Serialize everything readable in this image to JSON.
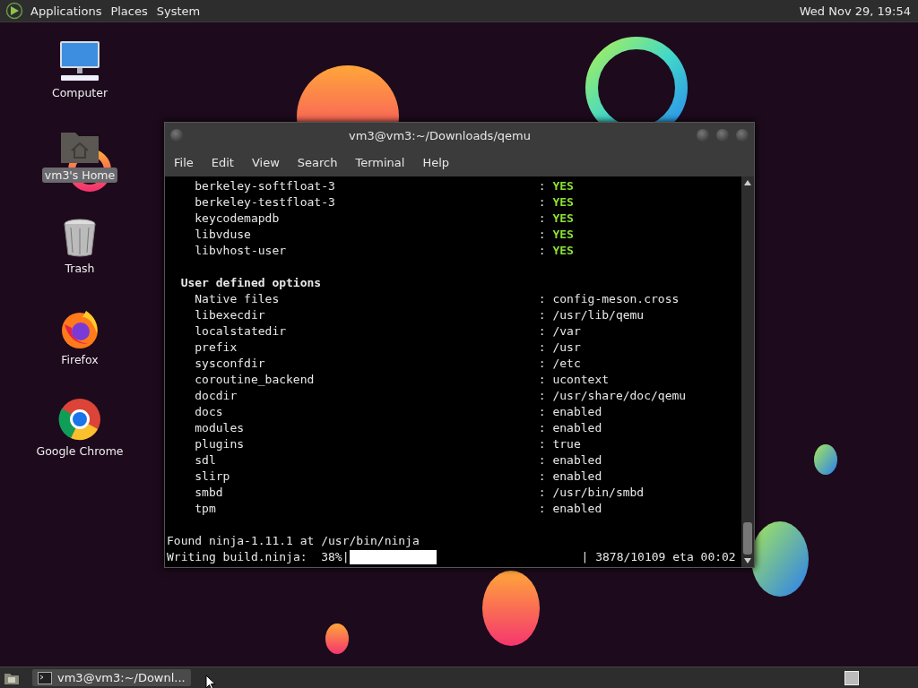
{
  "top_panel": {
    "menus": [
      "Applications",
      "Places",
      "System"
    ],
    "clock": "Wed Nov 29, 19:54"
  },
  "desktop_icons": [
    {
      "label": "Computer",
      "kind": "computer",
      "selected": false
    },
    {
      "label": "vm3's Home",
      "kind": "home",
      "selected": true
    },
    {
      "label": "Trash",
      "kind": "trash",
      "selected": false
    },
    {
      "label": "Firefox",
      "kind": "firefox",
      "selected": false
    },
    {
      "label": "Google Chrome",
      "kind": "chrome",
      "selected": false
    }
  ],
  "window": {
    "title": "vm3@vm3:~/Downloads/qemu",
    "menu": [
      "File",
      "Edit",
      "View",
      "Search",
      "Terminal",
      "Help"
    ]
  },
  "terminal_lines": [
    {
      "kind": "entry",
      "key": "berkeley-softfloat-3",
      "sep": ":",
      "value": "YES",
      "highlight": true
    },
    {
      "kind": "entry",
      "key": "berkeley-testfloat-3",
      "sep": ":",
      "value": "YES",
      "highlight": true
    },
    {
      "kind": "entry",
      "key": "keycodemapdb",
      "sep": ":",
      "value": "YES",
      "highlight": true
    },
    {
      "kind": "entry",
      "key": "libvduse",
      "sep": ":",
      "value": "YES",
      "highlight": true
    },
    {
      "kind": "entry",
      "key": "libvhost-user",
      "sep": ":",
      "value": "YES",
      "highlight": true
    },
    {
      "kind": "blank"
    },
    {
      "kind": "heading",
      "text": "User defined options"
    },
    {
      "kind": "entry",
      "key": "Native files",
      "sep": ":",
      "value": "config-meson.cross",
      "highlight": false
    },
    {
      "kind": "entry",
      "key": "libexecdir",
      "sep": ":",
      "value": "/usr/lib/qemu",
      "highlight": false
    },
    {
      "kind": "entry",
      "key": "localstatedir",
      "sep": ":",
      "value": "/var",
      "highlight": false
    },
    {
      "kind": "entry",
      "key": "prefix",
      "sep": ":",
      "value": "/usr",
      "highlight": false
    },
    {
      "kind": "entry",
      "key": "sysconfdir",
      "sep": ":",
      "value": "/etc",
      "highlight": false
    },
    {
      "kind": "entry",
      "key": "coroutine_backend",
      "sep": ":",
      "value": "ucontext",
      "highlight": false
    },
    {
      "kind": "entry",
      "key": "docdir",
      "sep": ":",
      "value": "/usr/share/doc/qemu",
      "highlight": false
    },
    {
      "kind": "entry",
      "key": "docs",
      "sep": ":",
      "value": "enabled",
      "highlight": false
    },
    {
      "kind": "entry",
      "key": "modules",
      "sep": ":",
      "value": "enabled",
      "highlight": false
    },
    {
      "kind": "entry",
      "key": "plugins",
      "sep": ":",
      "value": "true",
      "highlight": false
    },
    {
      "kind": "entry",
      "key": "sdl",
      "sep": ":",
      "value": "enabled",
      "highlight": false
    },
    {
      "kind": "entry",
      "key": "slirp",
      "sep": ":",
      "value": "enabled",
      "highlight": false
    },
    {
      "kind": "entry",
      "key": "smbd",
      "sep": ":",
      "value": "/usr/bin/smbd",
      "highlight": false
    },
    {
      "kind": "entry",
      "key": "tpm",
      "sep": ":",
      "value": "enabled",
      "highlight": false
    },
    {
      "kind": "blank"
    },
    {
      "kind": "text",
      "text": "Found ninja-1.11.1 at /usr/bin/ninja"
    },
    {
      "kind": "progress",
      "label": "Writing build.ninja:  38%|",
      "level": 0.38,
      "status": "| 3878/10109 eta 00:02"
    }
  ],
  "taskbar": {
    "tasks": [
      {
        "label": "vm3@vm3:~/Downl...",
        "selected": false
      }
    ]
  }
}
